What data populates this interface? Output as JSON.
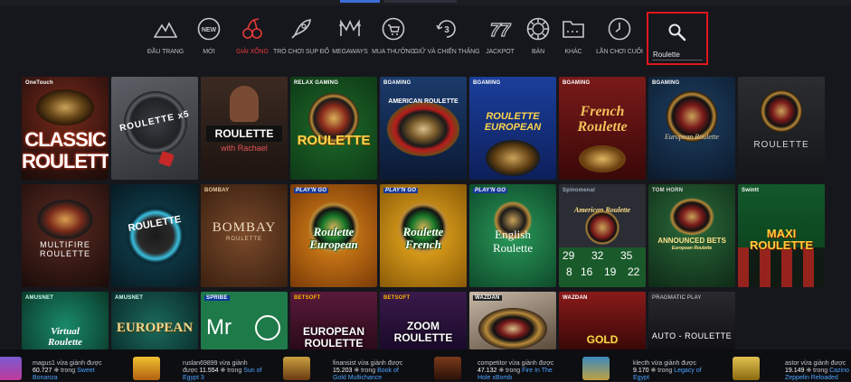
{
  "nav": {
    "items": [
      {
        "label": "ĐẦU TRANG",
        "icon": "mountain-icon"
      },
      {
        "label": "MỚI",
        "icon": "new-badge-icon",
        "badge": "NEW"
      },
      {
        "label": "GIẢI XỔNG",
        "icon": "cherries-icon",
        "active": true
      },
      {
        "label": "TRÒ CHƠI SỤP ĐỔ",
        "icon": "rocket-icon"
      },
      {
        "label": "MEGAWAYS",
        "icon": "megaways-icon"
      },
      {
        "label": "MUA THƯỞNG",
        "icon": "bonus-buy-icon"
      },
      {
        "label": "GIỮ VÀ CHIẾN THẮNG",
        "icon": "hold-and-win-icon",
        "badge": "3"
      },
      {
        "label": "JACKPOT",
        "icon": "jackpot-icon",
        "badge": "77"
      },
      {
        "label": "BÀN",
        "icon": "chip-icon"
      },
      {
        "label": "KHÁC",
        "icon": "folder-icon"
      },
      {
        "label": "LẦN CHƠI CUỐI",
        "icon": "clock-icon"
      }
    ]
  },
  "search": {
    "value": "Roulette",
    "icon": "search-icon"
  },
  "games": [
    {
      "title": "CLASSIC ROULETTE",
      "brand": "OneTouch"
    },
    {
      "title": "ROULETTE x5",
      "brand": ""
    },
    {
      "title": "ROULETTE",
      "subtitle": "with Rachael",
      "brand": ""
    },
    {
      "title": "ROULETTE",
      "brand": "RELAX GAMING"
    },
    {
      "title": "AMERICAN ROULETTE",
      "brand": "BGAMING"
    },
    {
      "title": "ROULETTE EUROPEAN",
      "brand": "BGAMING"
    },
    {
      "title": "French Roulette",
      "brand": "BGAMING"
    },
    {
      "title": "European Roulette",
      "brand": "BGAMING"
    },
    {
      "title": "ROULETTE",
      "brand": ""
    },
    {
      "title": "MULTIFIRE ROULETTE",
      "brand": ""
    },
    {
      "title": "ROULETTE",
      "brand": ""
    },
    {
      "title": "BOMBAY",
      "subtitle": "ROULETTE",
      "brand": "BOMBAY"
    },
    {
      "title": "Roulette European",
      "brand": "PLAY'N GO"
    },
    {
      "title": "Roulette French",
      "brand": "PLAY'N GO"
    },
    {
      "title": "English Roulette",
      "brand": "PLAY'N GO"
    },
    {
      "title": "American Roulette",
      "brand": "Spinomenal",
      "numbers": [
        "29",
        "32",
        "35",
        "8",
        "16",
        "19",
        "22"
      ]
    },
    {
      "title": "ANNOUNCED BETS",
      "subtitle": "European Roulette",
      "brand": "TOM HORN"
    },
    {
      "title": "MAXI ROULETTE",
      "brand": "Swintt"
    },
    {
      "title": "Virtual Roulette",
      "brand": "AMUSNET"
    },
    {
      "title": "EUROPEAN",
      "brand": "AMUSNET"
    },
    {
      "title": "Mr",
      "brand": "SPRIBE"
    },
    {
      "title": "EUROPEAN ROULETTE",
      "brand": "BETSOFT"
    },
    {
      "title": "ZOOM ROULETTE",
      "brand": "BETSOFT"
    },
    {
      "title": "",
      "brand": "WAZDAN"
    },
    {
      "title": "GOLD",
      "brand": "WAZDAN"
    },
    {
      "title": "AUTO - ROULETTE",
      "brand": "PRAGMATIC PLAY"
    }
  ],
  "ticker": [
    {
      "line1": "magus1 vừa giành được",
      "amount": "60.727",
      "mid": " trong ",
      "game": "Sweet",
      "line3": "Bonanza"
    },
    {
      "line1": "ruslan69899 vừa giành",
      "line2": "được ",
      "amount": "11.554",
      "mid": " trong ",
      "game": "Sun of",
      "line3": "Egypt 3"
    },
    {
      "line1": "finansist vừa giành được",
      "amount": "15.203",
      "mid": " trong ",
      "game": "Book of",
      "line3": "Gold Multichance"
    },
    {
      "line1": "competitor vừa giành được",
      "amount": "47.132",
      "mid": " trong ",
      "game": "Fire In The",
      "line3": "Hole xBomb"
    },
    {
      "line1": "klecth vừa giành được",
      "amount": "9.170",
      "mid": " trong ",
      "game": "Legacy of",
      "line3": "Egypt"
    },
    {
      "line1": "astor vừa giành được",
      "amount": "19.149",
      "mid": " trong ",
      "game": "Cazino",
      "line3": "Zeppelin Reloaded"
    }
  ]
}
